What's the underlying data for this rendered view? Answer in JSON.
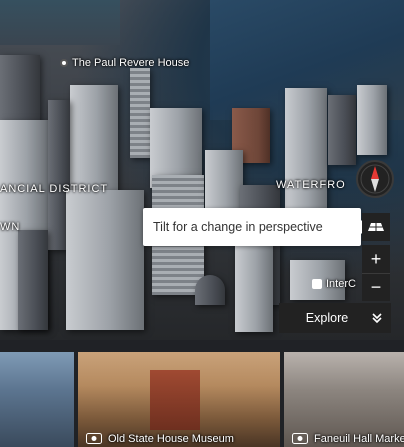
{
  "map": {
    "labels": {
      "financial_district": "ANCIAL DISTRICT",
      "waterfront": "WATERFRO",
      "downtown_fragment": "WN"
    },
    "pois": {
      "paul_revere": "The Paul Revere House",
      "intercontinental": "InterC"
    }
  },
  "tooltip": {
    "text": "Tilt for a change in perspective"
  },
  "controls": {
    "zoom_in": "+",
    "zoom_out": "−"
  },
  "explore": {
    "label": "Explore"
  },
  "cards": [
    {
      "title": ""
    },
    {
      "title": "Old State House Museum"
    },
    {
      "title": "Faneuil Hall Marke"
    }
  ],
  "colors": {
    "control_bg": "#222222",
    "compass_north": "#e53935",
    "tooltip_bg": "#ffffff"
  }
}
